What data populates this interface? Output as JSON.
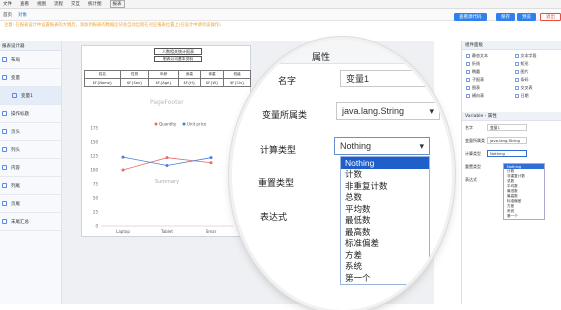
{
  "menu": [
    "文件",
    "查看",
    "视图",
    "流程",
    "交互"
  ],
  "menu_extra": [
    "统计图",
    "报表"
  ],
  "toolbar": {
    "items": [
      "首页",
      "对象",
      "—"
    ],
    "note": "注意: 在报表设计中设置报表的大纲后，添加到报表的数据区块会自动出现在对应报表位置上(在设计中请勿误操作)"
  },
  "buttons": {
    "b1": "查看源代码",
    "b2": "保存",
    "b3": "预览",
    "b4": "退出"
  },
  "left": {
    "header": "报表设计器",
    "items": [
      "布局",
      "变量",
      "变量1",
      "操作标题",
      "页头",
      "列头",
      "内容",
      "列尾",
      "页尾",
      "末尾汇总"
    ]
  },
  "page": {
    "title": "人数相关统计报表",
    "subtitle": "制表公司基本资料",
    "headers": [
      "姓名",
      "性别",
      "年龄",
      "身高",
      "体重",
      "班级"
    ],
    "cells": [
      "$F{Name}",
      "$F{Sex}",
      "$F{Age}",
      "$F{H}",
      "$F{W}",
      "$F{Cls}"
    ],
    "pagefooter": "PageFooter"
  },
  "chart_data": {
    "type": "line",
    "title": "",
    "categories": [
      "Laptop",
      "Tablet",
      "Smartphone"
    ],
    "category_labels": [
      "Laptop",
      "Tablet",
      "Smar"
    ],
    "series": [
      {
        "name": "Quantity",
        "values": [
          100,
          122,
          113
        ],
        "color": "#e86a6a"
      },
      {
        "name": "Unit price",
        "values": [
          123,
          108,
          122
        ],
        "color": "#4c7fd8"
      }
    ],
    "ylim": [
      0,
      175
    ],
    "yticks": [
      "175",
      "150",
      "125",
      "100",
      "75",
      "50",
      "25",
      "0"
    ],
    "summary": "Summary"
  },
  "right": {
    "header": "组件面板",
    "palette": [
      "静态文本",
      "文本字段",
      "折线",
      "矩形",
      "椭圆",
      "图片",
      "子报表",
      "条码",
      "图表",
      "交叉表",
      "横向表",
      "日期"
    ],
    "var_header": "Variable - 属性",
    "rows": [
      {
        "label": "名字",
        "value": "变量1"
      },
      {
        "label": "变量所属类",
        "value": "java.lang.String"
      },
      {
        "label": "计算类型",
        "value": "Nothing"
      },
      {
        "label": "重置类型",
        "value": ""
      },
      {
        "label": "表达式",
        "value": ""
      }
    ]
  },
  "magnifier": {
    "section": "属性",
    "name_label": "名字",
    "name_value": "变量1",
    "class_label": "变量所属类",
    "class_value": "java.lang.String",
    "calc_label": "计算类型",
    "calc_value": "Nothing",
    "reset_label": "重置类型",
    "expr_label": "表达式",
    "options": [
      "Nothing",
      "计数",
      "非重复计数",
      "总数",
      "平均数",
      "最低数",
      "最高数",
      "标准偏差",
      "方差",
      "系统",
      "第一个"
    ]
  }
}
